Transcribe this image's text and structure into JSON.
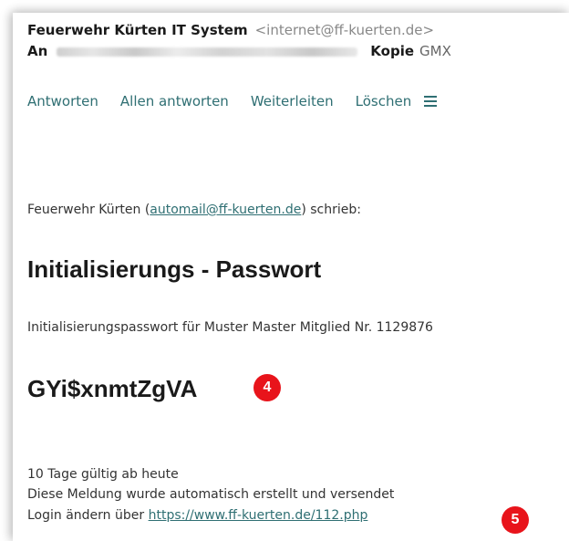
{
  "email": {
    "from_name": "Feuerwehr Kürten IT System",
    "from_email": "<internet@ff-kuerten.de>",
    "to_label": "An",
    "cc_label": "Kopie",
    "cc_value": "GMX"
  },
  "actions": {
    "reply": "Antworten",
    "reply_all": "Allen antworten",
    "forward": "Weiterleiten",
    "delete": "Löschen",
    "menu_icon": "hamburger-menu-icon"
  },
  "content": {
    "quote_prefix": "Feuerwehr Kürten (",
    "quote_email": "automail@ff-kuerten.de",
    "quote_suffix": ") schrieb:",
    "heading": "Initialisierungs - Passwort",
    "description": "Initialisierungspasswort für Muster Master Mitglied Nr. 1129876",
    "password": "GYi$xnmtZgVA",
    "validity": "10 Tage gültig ab heute",
    "auto_note": "Diese Meldung wurde automatisch erstellt und versendet",
    "login_prefix": "Login ändern über ",
    "login_link": "https://www.ff-kuerten.de/112.php"
  },
  "badges": {
    "step4": "4",
    "step5": "5"
  },
  "colors": {
    "link": "#2f6f73",
    "badge": "#e8141b"
  }
}
